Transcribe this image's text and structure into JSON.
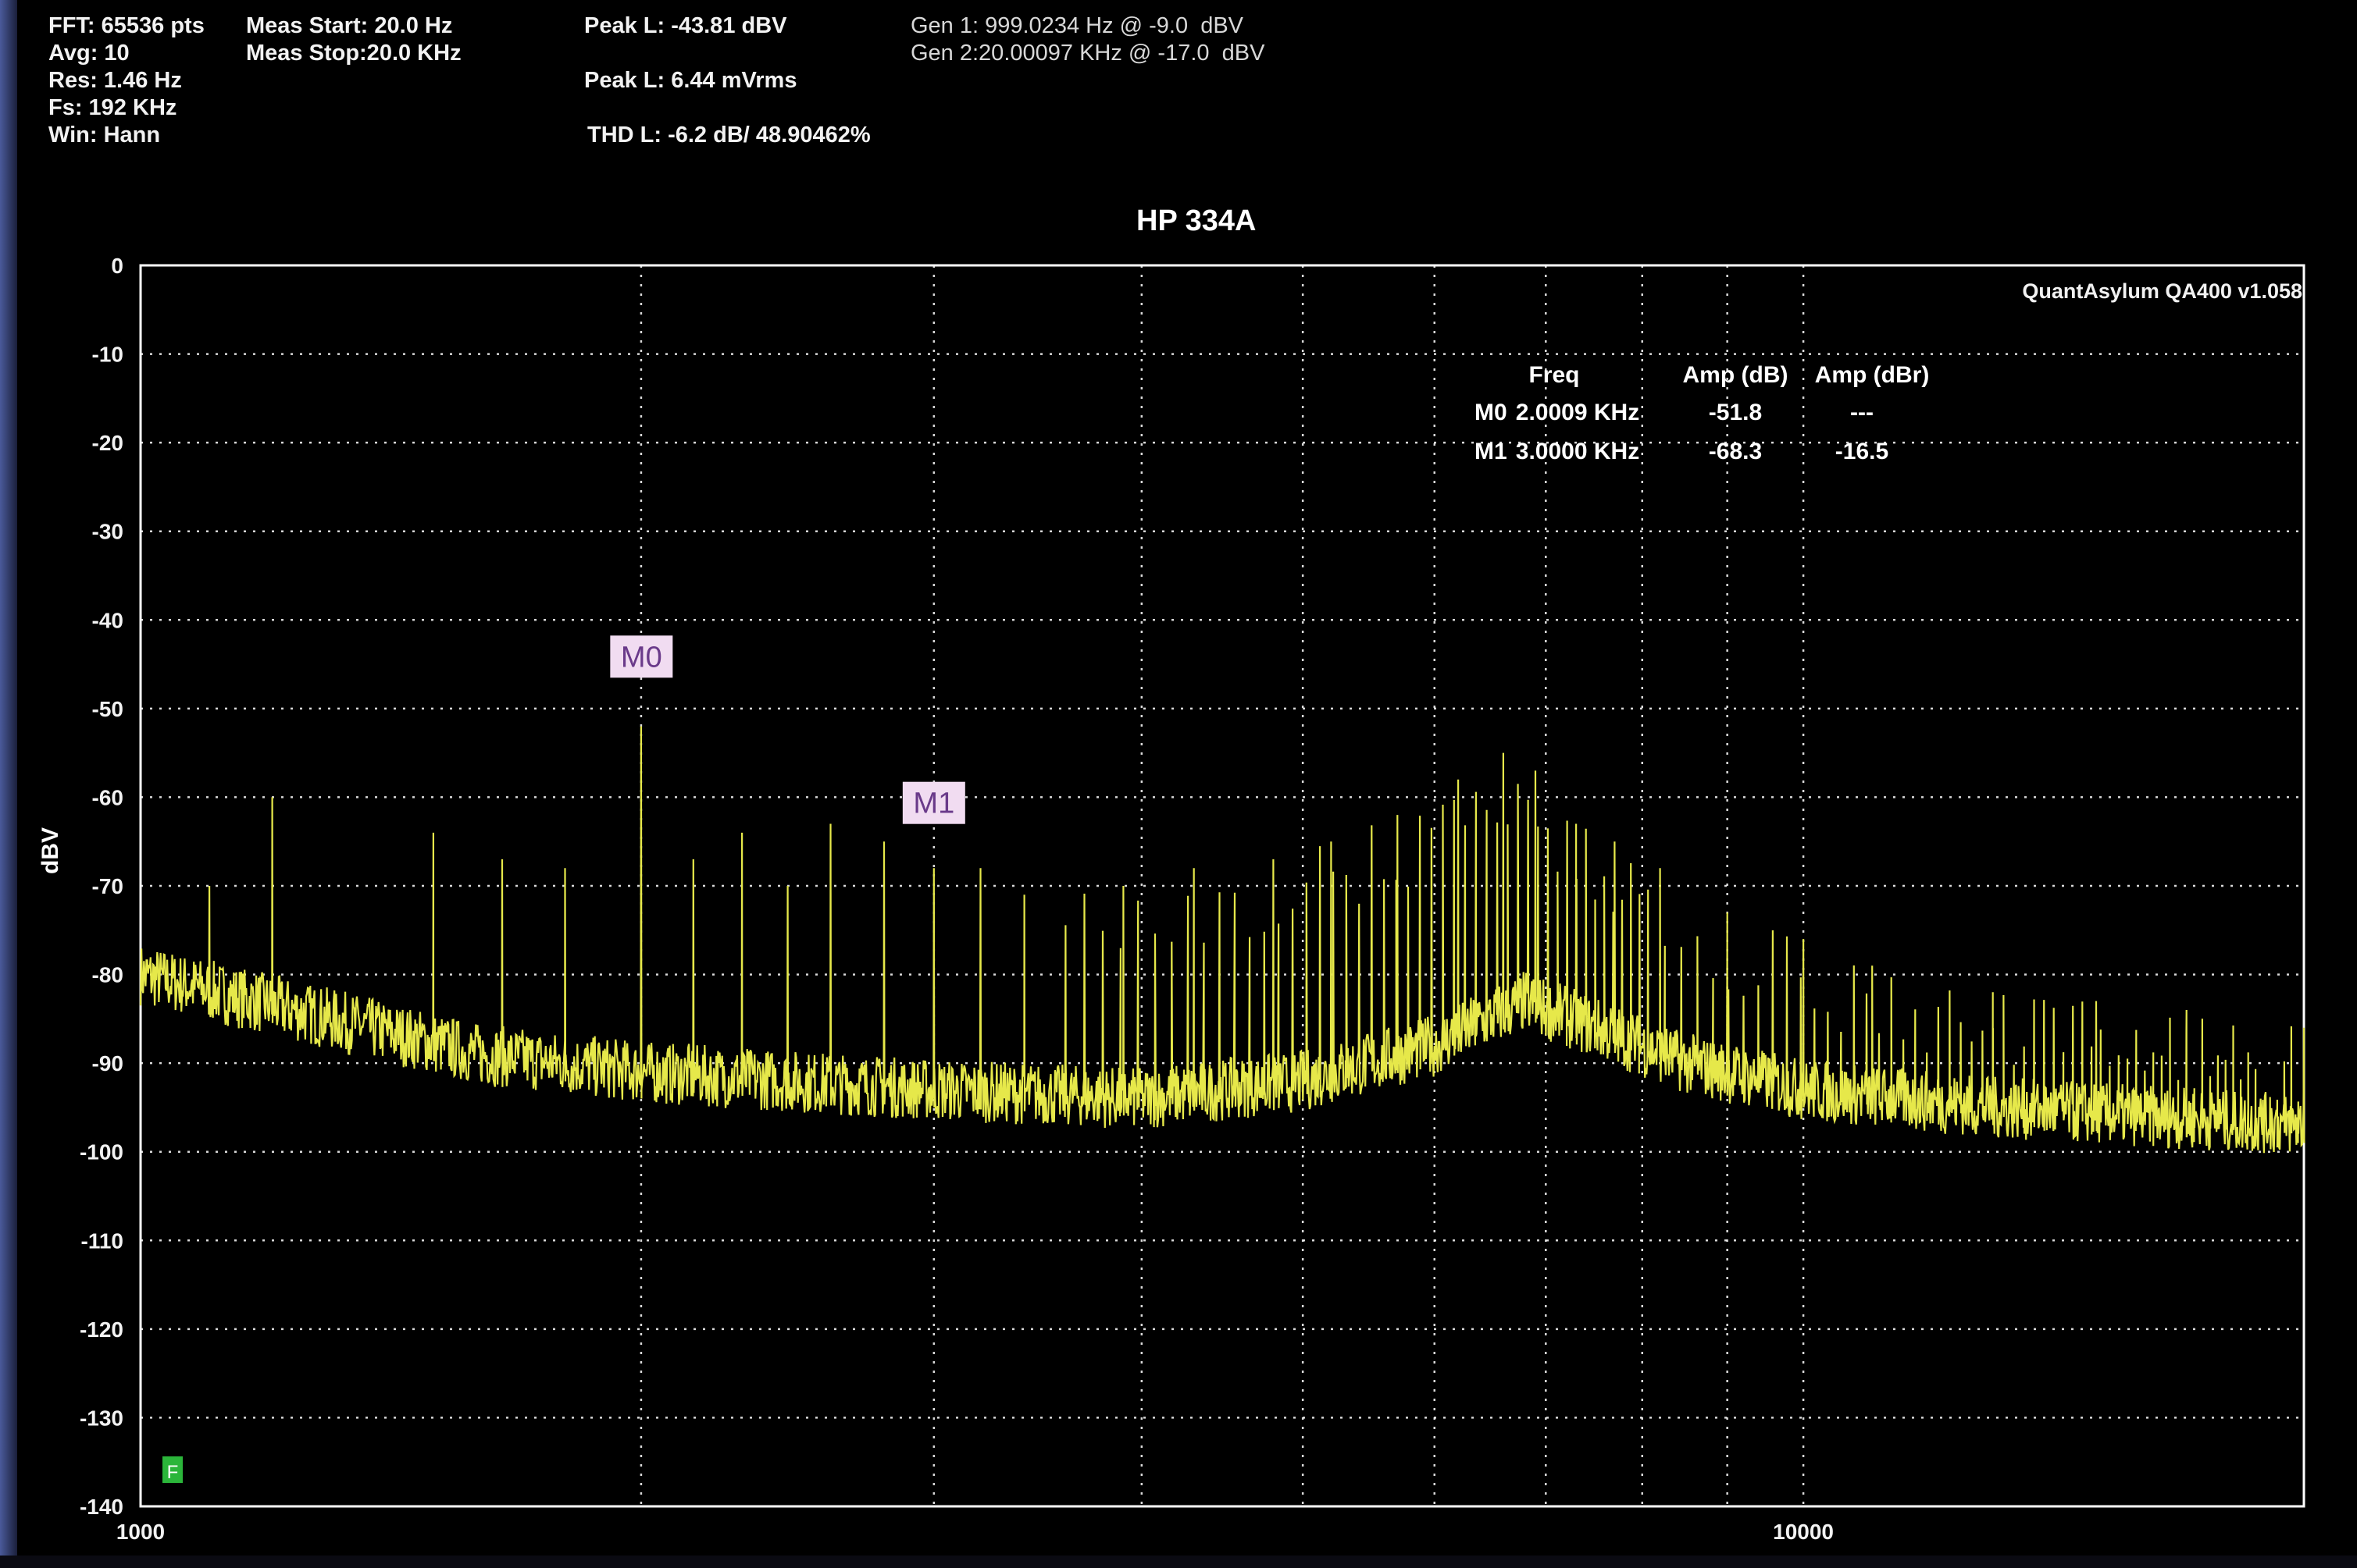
{
  "header": {
    "fft": "FFT: 65536 pts",
    "avg": "Avg: 10",
    "res": "Res: 1.46 Hz",
    "fs": "Fs: 192 KHz",
    "win": "Win: Hann",
    "meas_start": "Meas Start: 20.0 Hz",
    "meas_stop": "Meas Stop:20.0 KHz",
    "peak_dbv": "Peak L: -43.81 dBV",
    "peak_mvrms": "Peak L: 6.44 mVrms",
    "thd": "THD L: -6.2 dB/ 48.90462%",
    "gen1": "Gen 1: 999.0234 Hz @ -9.0  dBV",
    "gen2": "Gen 2:20.00097 KHz @ -17.0  dBV"
  },
  "watermark": "QuantAsylum QA400 v1.058",
  "marker_table": {
    "headers": [
      "Freq",
      "Amp (dB)",
      "Amp (dBr)"
    ],
    "rows": [
      {
        "name": "M0",
        "freq": "2.0009 KHz",
        "amp_db": "-51.8",
        "amp_dbr": "---"
      },
      {
        "name": "M1",
        "freq": "3.0000 KHz",
        "amp_db": "-68.3",
        "amp_dbr": "-16.5"
      }
    ]
  },
  "markers": [
    {
      "label": "M0",
      "freq_hz": 2000.9,
      "amp_db": -51.8
    },
    {
      "label": "M1",
      "freq_hz": 3000.0,
      "amp_db": -68.3
    }
  ],
  "reference_flag": "F",
  "colors": {
    "background": "#000000",
    "trace": "#e6e84a",
    "grid": "#ffffff",
    "marker_box": "#f1dcf1",
    "ref_flag": "#2bb53a"
  },
  "chart_data": {
    "type": "line",
    "title": "HP 334A",
    "xlabel": "",
    "ylabel": "dBV",
    "x_scale": "log",
    "xlim": [
      1000,
      20000
    ],
    "ylim": [
      -140,
      0
    ],
    "x_ticks": [
      "1000",
      "10000"
    ],
    "y_ticks": [
      "0",
      "-10",
      "-20",
      "-30",
      "-40",
      "-50",
      "-60",
      "-70",
      "-80",
      "-90",
      "-100",
      "-110",
      "-120",
      "-130",
      "-140"
    ],
    "grid": true,
    "series": [
      {
        "name": "",
        "noise_floor": [
          [
            1000,
            -80
          ],
          [
            1300,
            -85
          ],
          [
            1600,
            -89
          ],
          [
            2000,
            -91
          ],
          [
            3000,
            -93
          ],
          [
            4000,
            -94
          ],
          [
            5000,
            -92
          ],
          [
            6000,
            -88
          ],
          [
            6800,
            -83
          ],
          [
            7500,
            -86
          ],
          [
            8500,
            -90
          ],
          [
            10000,
            -93
          ],
          [
            13000,
            -95
          ],
          [
            20000,
            -97
          ]
        ],
        "peaks": [
          [
            1100,
            -70
          ],
          [
            1200,
            -60
          ],
          [
            1500,
            -64
          ],
          [
            1650,
            -67
          ],
          [
            1800,
            -68
          ],
          [
            2000,
            -52
          ],
          [
            2150,
            -67
          ],
          [
            2300,
            -64
          ],
          [
            2450,
            -70
          ],
          [
            2600,
            -63
          ],
          [
            2800,
            -65
          ],
          [
            3000,
            -68
          ],
          [
            3200,
            -68
          ],
          [
            3400,
            -71
          ],
          [
            3900,
            -70
          ],
          [
            4300,
            -68
          ],
          [
            4800,
            -67
          ],
          [
            5200,
            -65
          ],
          [
            5700,
            -62
          ],
          [
            6200,
            -58
          ],
          [
            6600,
            -55
          ],
          [
            6900,
            -57
          ],
          [
            7300,
            -63
          ],
          [
            7700,
            -65
          ],
          [
            8200,
            -68
          ],
          [
            9000,
            -73
          ],
          [
            10000,
            -76
          ],
          [
            11000,
            -79
          ],
          [
            13000,
            -82
          ],
          [
            15000,
            -83
          ],
          [
            17000,
            -84
          ],
          [
            20000,
            -86
          ]
        ]
      }
    ]
  }
}
